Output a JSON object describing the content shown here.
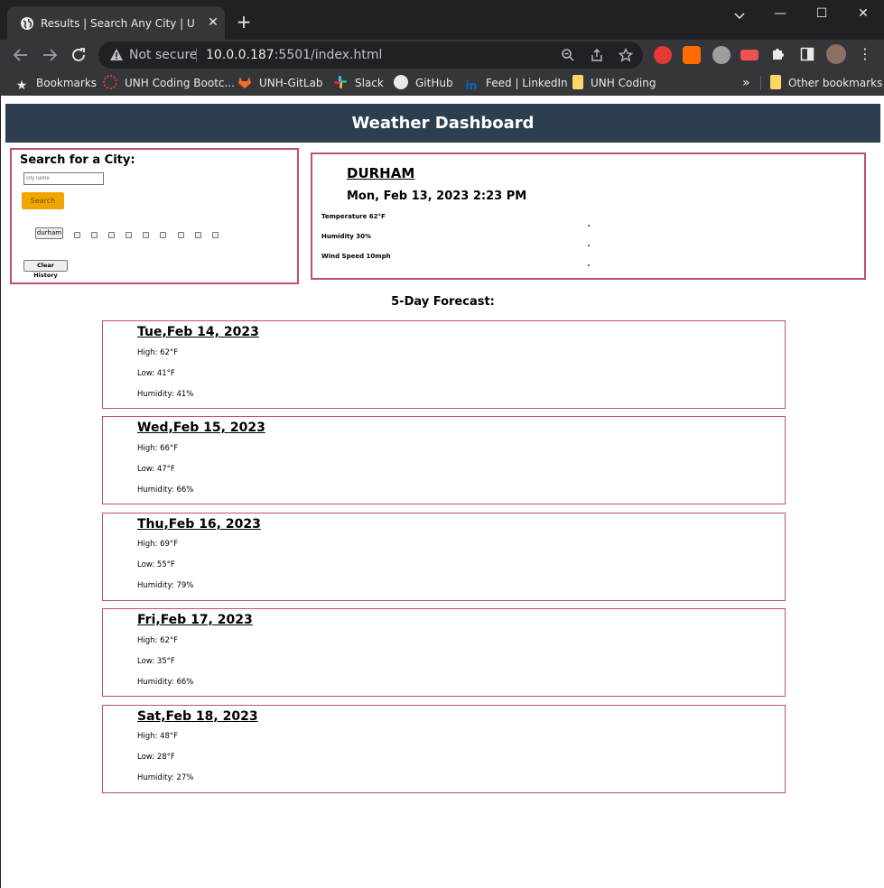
{
  "browser": {
    "tab_title": "Results | Search Any City | Up To Date Weather",
    "url_warning": "Not secure",
    "url_host": "10.0.0.187",
    "url_path": ":5501/index.html",
    "bookmarks": [
      {
        "label": "Bookmarks",
        "icon": "star-icon"
      },
      {
        "label": "UNH Coding Bootc...",
        "icon": "bootcamp-icon"
      },
      {
        "label": "UNH-GitLab",
        "icon": "gitlab-icon"
      },
      {
        "label": "Slack",
        "icon": "slack-icon"
      },
      {
        "label": "GitHub",
        "icon": "github-icon"
      },
      {
        "label": "Feed | LinkedIn",
        "icon": "linkedin-icon"
      },
      {
        "label": "UNH Coding",
        "icon": "folder-icon"
      }
    ],
    "overflow_label": "»",
    "other_bookmarks": "Other bookmarks"
  },
  "page": {
    "header": "Weather Dashboard",
    "search": {
      "title": "Search for a City:",
      "placeholder": "city name",
      "button": "Search",
      "history": [
        "durham"
      ],
      "clear": "Clear History"
    },
    "current": {
      "city": "DURHAM",
      "datetime": "Mon, Feb 13, 2023 2:23 PM",
      "temperature": "Temperature 62°F",
      "humidity": "Humidity 30%",
      "wind": "Wind Speed 10mph"
    },
    "forecast_title": "5-Day Forecast:",
    "forecast": [
      {
        "date": "Tue,Feb 14, 2023",
        "high": "High: 62°F",
        "low": "Low: 41°F",
        "humidity": "Humidity: 41%"
      },
      {
        "date": "Wed,Feb 15, 2023",
        "high": "High: 66°F",
        "low": "Low: 47°F",
        "humidity": "Humidity: 66%"
      },
      {
        "date": "Thu,Feb 16, 2023",
        "high": "High: 69°F",
        "low": "Low: 55°F",
        "humidity": "Humidity: 79%"
      },
      {
        "date": "Fri,Feb 17, 2023",
        "high": "High: 62°F",
        "low": "Low: 35°F",
        "humidity": "Humidity: 66%"
      },
      {
        "date": "Sat,Feb 18, 2023",
        "high": "High: 48°F",
        "low": "Low: 28°F",
        "humidity": "Humidity: 27%"
      }
    ]
  },
  "colors": {
    "header_bg": "#2c3e50",
    "card_border": "#c0506b",
    "search_button": "#f0a500"
  }
}
